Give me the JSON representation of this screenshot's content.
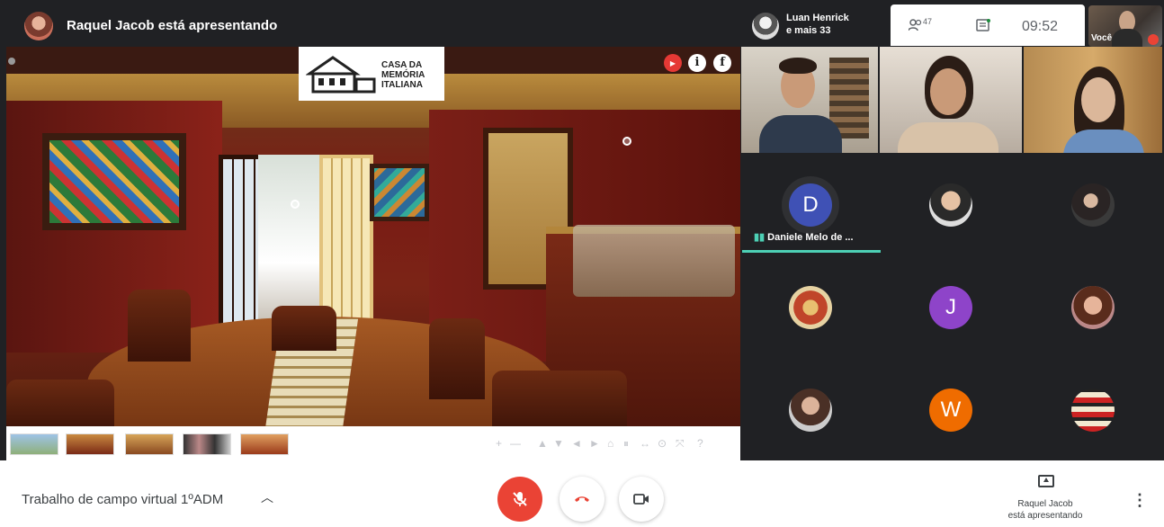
{
  "top": {
    "presenter_banner": "Raquel Jacob está apresentando",
    "others_line1": "Luan Henrick",
    "others_line2": "e mais 33",
    "people_count": "47",
    "time": "09:52",
    "self_label": "Você"
  },
  "presentation": {
    "logo_text": [
      "CASA DA",
      "MEMÓRIA",
      "ITALIANA"
    ],
    "controls": [
      "+",
      "—",
      "▲",
      "▼",
      "◄",
      "►",
      "⌂",
      "⏸",
      "↔",
      "⊙",
      "⤧",
      "?"
    ]
  },
  "participants": {
    "speaker_name": "Daniele Melo de ...",
    "speaker_initial": "D",
    "initials": [
      "J",
      "W"
    ],
    "colors": {
      "d": "#3f51b5",
      "j": "#8e44c9",
      "w": "#ef6c00",
      "speaking": "#4dd0b5"
    }
  },
  "bottom": {
    "meeting_title": "Trabalho de campo virtual 1ºADM",
    "presenting_line1": "Raquel Jacob",
    "presenting_line2": "está apresentando"
  }
}
